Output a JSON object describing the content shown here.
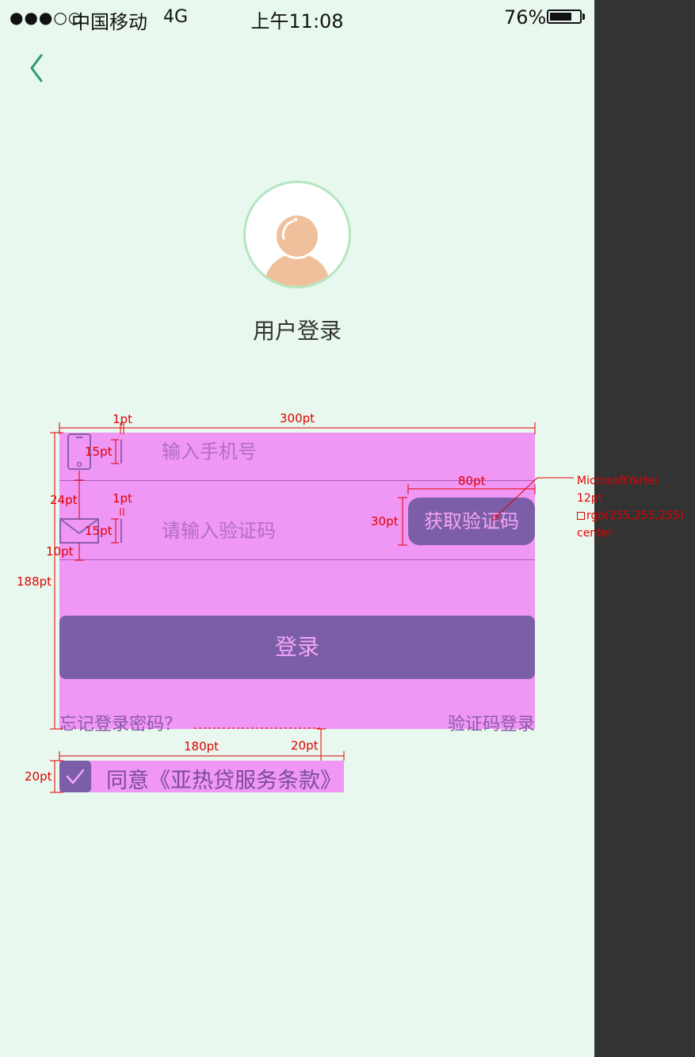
{
  "status_bar": {
    "signal": "●●●○○",
    "carrier": "中国移动",
    "network": "4G",
    "time": "上午11:08",
    "battery_percent": "76%",
    "battery_level": 0.76
  },
  "header": {
    "back_icon": "chevron-left-icon"
  },
  "profile": {
    "avatar_icon": "user-avatar-icon",
    "title": "用户登录"
  },
  "form": {
    "phone": {
      "icon": "mobile-phone-icon",
      "placeholder": "输入手机号",
      "value": ""
    },
    "code": {
      "icon": "envelope-icon",
      "placeholder": "请输入验证码",
      "value": "",
      "button_label": "获取验证码"
    },
    "login_label": "登录",
    "forgot_password": "忘记登录密码？",
    "code_login": "验证码登录"
  },
  "agreement": {
    "checked": true,
    "text": "同意《亚热贷服务条款》"
  },
  "annotations": {
    "w_1pt_a": "1pt",
    "w_300pt": "300pt",
    "h_15pt_a": "15pt",
    "w_1pt_b": "1pt",
    "h_24pt": "24pt",
    "h_15pt_b": "15pt",
    "h_10pt": "10pt",
    "h_188pt": "188pt",
    "w_80pt": "80pt",
    "h_30pt": "30pt",
    "w_180pt": "180pt",
    "w_20pt": "20pt",
    "h_20pt": "20pt",
    "font_spec": {
      "font": "MicrosoftYaHei",
      "size": "12pt",
      "color": "rgb(255,255,255)",
      "align": "center"
    }
  },
  "colors": {
    "page_bg": "#e8f8ee",
    "side_bg": "#333333",
    "form_bg": "#f096f4",
    "accent": "#7b5ea7",
    "accent_text": "#f4a6f6",
    "back_icon": "#2e9a72",
    "annotation": "#e00000"
  }
}
